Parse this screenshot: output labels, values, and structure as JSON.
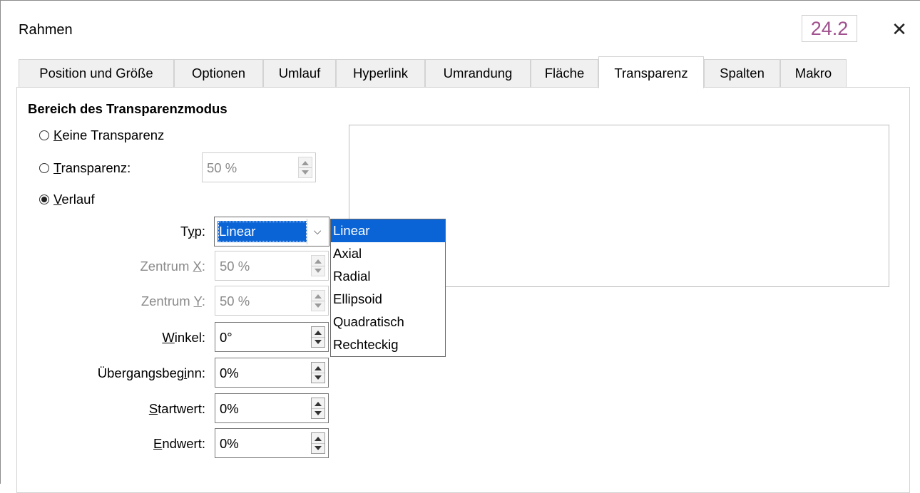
{
  "window": {
    "title": "Rahmen",
    "version": "24.2",
    "close_glyph": "✕"
  },
  "tabs": [
    {
      "label": "Position und Größe"
    },
    {
      "label": "Optionen"
    },
    {
      "label": "Umlauf"
    },
    {
      "label": "Hyperlink"
    },
    {
      "label": "Umrandung"
    },
    {
      "label": "Fläche"
    },
    {
      "label": "Transparenz"
    },
    {
      "label": "Spalten"
    },
    {
      "label": "Makro"
    }
  ],
  "active_tab": "Transparenz",
  "section": {
    "heading": "Bereich des Transparenzmodus",
    "radios": [
      {
        "mnemonic": "K",
        "rest": "eine Transparenz",
        "checked": false
      },
      {
        "mnemonic": "T",
        "rest": "ransparenz:",
        "checked": false,
        "value": "50 %"
      },
      {
        "mnemonic": "V",
        "rest": "erlauf",
        "checked": true
      }
    ]
  },
  "gradient": {
    "typ": {
      "label_pre": "T",
      "label_u": "y",
      "label_post": "p:",
      "value": "Linear",
      "options": [
        "Linear",
        "Axial",
        "Radial",
        "Ellipsoid",
        "Quadratisch",
        "Rechteckig"
      ],
      "selected": "Linear"
    },
    "center_x": {
      "label_pre": "Zentrum ",
      "label_u": "X",
      "label_post": ":",
      "value": "50 %",
      "disabled": true
    },
    "center_y": {
      "label_pre": "Zentrum ",
      "label_u": "Y",
      "label_post": ":",
      "value": "50 %",
      "disabled": true
    },
    "angle": {
      "label_pre": "",
      "label_u": "W",
      "label_post": "inkel:",
      "value": "0°"
    },
    "border": {
      "label_pre": "Übergangsbeg",
      "label_u": "i",
      "label_post": "nn:",
      "value": "0%"
    },
    "start": {
      "label_pre": "",
      "label_u": "S",
      "label_post": "tartwert:",
      "value": "0%"
    },
    "end": {
      "label_pre": "",
      "label_u": "E",
      "label_post": "ndwert:",
      "value": "0%"
    }
  },
  "colors": {
    "accent": "#0a64d6",
    "badge": "#a0508e"
  },
  "icons": {
    "close": "close-icon",
    "dropdown": "chevron-down-icon",
    "spin": "spin-arrows-icon"
  }
}
